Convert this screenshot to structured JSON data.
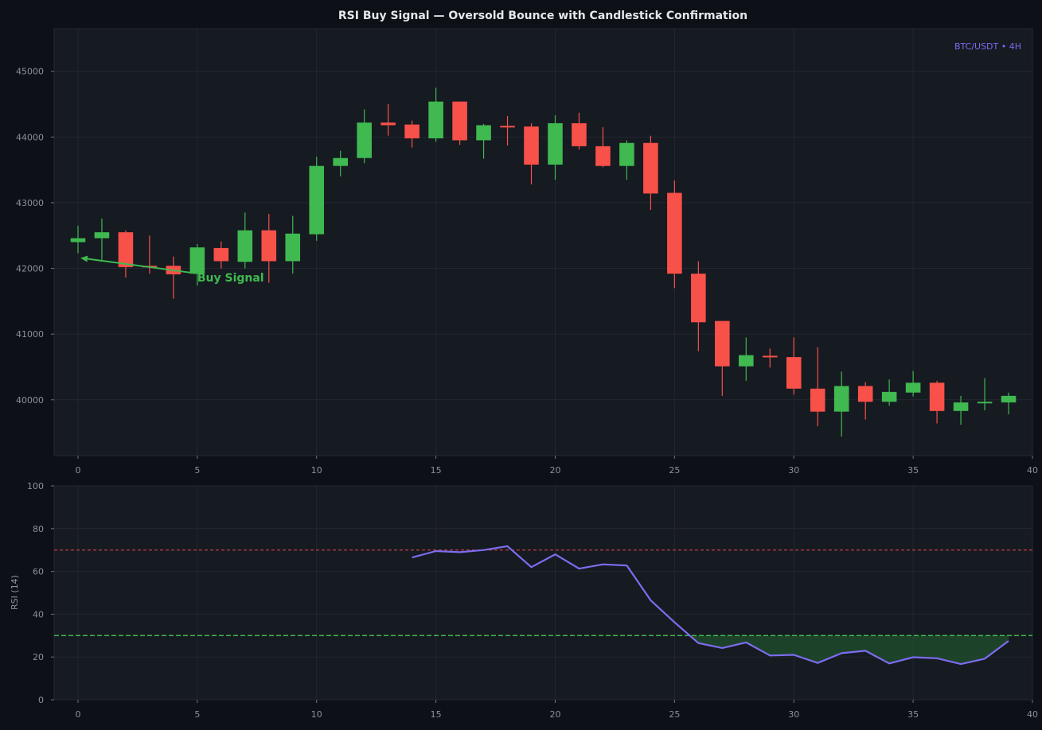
{
  "chart_data": [
    {
      "type": "candlestick",
      "title": "RSI Buy Signal — Oversold Bounce with Candlestick Confirmation",
      "tag": "BTC/USDT • 4H",
      "xlabel": "",
      "ylabel": "",
      "xlim": [
        -1,
        40
      ],
      "ylim": [
        39150,
        45650
      ],
      "x_ticks": [
        0,
        5,
        10,
        15,
        20,
        25,
        30,
        35,
        40
      ],
      "y_ticks": [
        40000,
        41000,
        42000,
        43000,
        44000,
        45000
      ],
      "grid": true,
      "colors": {
        "up": "#3fb950",
        "down": "#f85149",
        "accent": "#7c6cf0"
      },
      "annotation": {
        "text": "Buy Signal",
        "x": 5,
        "y": 41900,
        "arrow_to_x": 0.1,
        "arrow_to_y": 42160,
        "color": "#3fb950"
      },
      "candles": [
        {
          "x": 0,
          "open": 42400,
          "close": 42460,
          "high": 42650,
          "low": 42230
        },
        {
          "x": 1,
          "open": 42460,
          "close": 42550,
          "high": 42760,
          "low": 42130
        },
        {
          "x": 2,
          "open": 42550,
          "close": 42020,
          "high": 42580,
          "low": 41860
        },
        {
          "x": 3,
          "open": 42040,
          "close": 42030,
          "high": 42500,
          "low": 41920
        },
        {
          "x": 4,
          "open": 42040,
          "close": 41910,
          "high": 42180,
          "low": 41540
        },
        {
          "x": 5,
          "open": 41920,
          "close": 42320,
          "high": 42370,
          "low": 41740
        },
        {
          "x": 6,
          "open": 42310,
          "close": 42110,
          "high": 42410,
          "low": 42000
        },
        {
          "x": 7,
          "open": 42100,
          "close": 42580,
          "high": 42850,
          "low": 42000
        },
        {
          "x": 8,
          "open": 42580,
          "close": 42110,
          "high": 42830,
          "low": 41780
        },
        {
          "x": 9,
          "open": 42110,
          "close": 42530,
          "high": 42800,
          "low": 41920
        },
        {
          "x": 10,
          "open": 42520,
          "close": 43560,
          "high": 43700,
          "low": 42420
        },
        {
          "x": 11,
          "open": 43560,
          "close": 43680,
          "high": 43790,
          "low": 43400
        },
        {
          "x": 12,
          "open": 43680,
          "close": 44220,
          "high": 44420,
          "low": 43600
        },
        {
          "x": 13,
          "open": 44220,
          "close": 44180,
          "high": 44500,
          "low": 44020
        },
        {
          "x": 14,
          "open": 44190,
          "close": 43980,
          "high": 44250,
          "low": 43840
        },
        {
          "x": 15,
          "open": 43980,
          "close": 44540,
          "high": 44750,
          "low": 43930
        },
        {
          "x": 16,
          "open": 44540,
          "close": 43950,
          "high": 44540,
          "low": 43880
        },
        {
          "x": 17,
          "open": 43950,
          "close": 44180,
          "high": 44200,
          "low": 43670
        },
        {
          "x": 18,
          "open": 44170,
          "close": 44160,
          "high": 44320,
          "low": 43870
        },
        {
          "x": 19,
          "open": 44160,
          "close": 43580,
          "high": 44210,
          "low": 43280
        },
        {
          "x": 20,
          "open": 43580,
          "close": 44210,
          "high": 44330,
          "low": 43350
        },
        {
          "x": 21,
          "open": 44210,
          "close": 43860,
          "high": 44370,
          "low": 43810
        },
        {
          "x": 22,
          "open": 43860,
          "close": 43560,
          "high": 44150,
          "low": 43540
        },
        {
          "x": 23,
          "open": 43560,
          "close": 43910,
          "high": 43950,
          "low": 43350
        },
        {
          "x": 24,
          "open": 43910,
          "close": 43140,
          "high": 44020,
          "low": 42890
        },
        {
          "x": 25,
          "open": 43150,
          "close": 41920,
          "high": 43340,
          "low": 41700
        },
        {
          "x": 26,
          "open": 41920,
          "close": 41180,
          "high": 42110,
          "low": 40740
        },
        {
          "x": 27,
          "open": 41200,
          "close": 40510,
          "high": 41200,
          "low": 40060
        },
        {
          "x": 28,
          "open": 40510,
          "close": 40680,
          "high": 40950,
          "low": 40290
        },
        {
          "x": 29,
          "open": 40670,
          "close": 40650,
          "high": 40780,
          "low": 40490
        },
        {
          "x": 30,
          "open": 40650,
          "close": 40170,
          "high": 40950,
          "low": 40080
        },
        {
          "x": 31,
          "open": 40170,
          "close": 39820,
          "high": 40800,
          "low": 39600
        },
        {
          "x": 32,
          "open": 39820,
          "close": 40210,
          "high": 40430,
          "low": 39440
        },
        {
          "x": 33,
          "open": 40210,
          "close": 39970,
          "high": 40270,
          "low": 39700
        },
        {
          "x": 34,
          "open": 39970,
          "close": 40120,
          "high": 40310,
          "low": 39910
        },
        {
          "x": 35,
          "open": 40110,
          "close": 40260,
          "high": 40440,
          "low": 40050
        },
        {
          "x": 36,
          "open": 40260,
          "close": 39830,
          "high": 40290,
          "low": 39640
        },
        {
          "x": 37,
          "open": 39830,
          "close": 39960,
          "high": 40060,
          "low": 39620
        },
        {
          "x": 38,
          "open": 39960,
          "close": 39970,
          "high": 40330,
          "low": 39840
        },
        {
          "x": 39,
          "open": 39960,
          "close": 40060,
          "high": 40110,
          "low": 39780
        }
      ]
    },
    {
      "type": "line",
      "xlabel": "",
      "ylabel": "RSI (14)",
      "xlim": [
        -1,
        40
      ],
      "ylim": [
        0,
        100
      ],
      "x_ticks": [
        0,
        5,
        10,
        15,
        20,
        25,
        30,
        35,
        40
      ],
      "y_ticks": [
        0,
        20,
        40,
        60,
        80,
        100
      ],
      "grid": true,
      "overbought": {
        "level": 70,
        "color": "#d9444a"
      },
      "oversold": {
        "level": 30,
        "color": "#3fb950"
      },
      "line_color": "#7c6cf0",
      "fill_below_oversold": "#1f4a2c",
      "x": [
        14,
        15,
        16,
        17,
        18,
        19,
        20,
        21,
        22,
        23,
        24,
        25,
        26,
        27,
        28,
        29,
        30,
        31,
        32,
        33,
        34,
        35,
        36,
        37,
        38,
        39
      ],
      "values": [
        66.5,
        69.5,
        69,
        70,
        71.8,
        62,
        68,
        61.3,
        63.3,
        62.8,
        46.5,
        36.2,
        26.5,
        24.2,
        26.8,
        20.7,
        21,
        17.2,
        21.8,
        22.9,
        17,
        19.9,
        19.4,
        16.7,
        19.2,
        27.5
      ]
    }
  ]
}
